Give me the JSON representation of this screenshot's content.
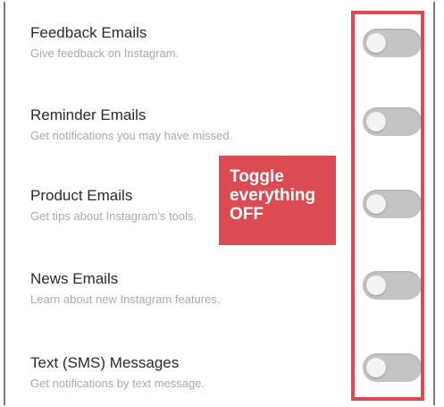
{
  "settings": [
    {
      "title": "Feedback Emails",
      "subtitle": "Give feedback on Instagram.",
      "enabled": false
    },
    {
      "title": "Reminder Emails",
      "subtitle": "Get notifications you may have missed.",
      "enabled": false
    },
    {
      "title": "Product Emails",
      "subtitle": "Get tips about Instagram's tools.",
      "enabled": false
    },
    {
      "title": "News Emails",
      "subtitle": "Learn about new Instagram features.",
      "enabled": false
    },
    {
      "title": "Text (SMS) Messages",
      "subtitle": "Get notifications by text message.",
      "enabled": false
    }
  ],
  "annotation": {
    "lines": [
      "Toggle",
      "everything",
      "OFF"
    ],
    "color": "#dd4b52"
  },
  "colors": {
    "toggle_off_track": "#c4c4c4",
    "toggle_knob": "#f3f3f3",
    "highlight_border": "#e0474f"
  }
}
